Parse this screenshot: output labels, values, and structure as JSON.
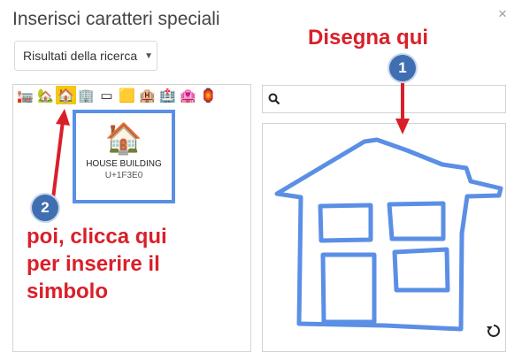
{
  "dialog": {
    "title": "Inserisci caratteri speciali",
    "close_icon": "×",
    "dropdown_label": "Risultati della ricerca"
  },
  "emoji_strip": [
    {
      "glyph": "🏣",
      "icon": "post-office-icon"
    },
    {
      "glyph": "🏡",
      "icon": "house-garden-icon"
    },
    {
      "glyph": "🏠",
      "icon": "house-building-icon",
      "selected": true
    },
    {
      "glyph": "🏢",
      "icon": "office-building-icon"
    },
    {
      "glyph": "▭",
      "icon": "empty-box-icon"
    },
    {
      "glyph": "🟨",
      "icon": "yellow-box-icon"
    },
    {
      "glyph": "🏨",
      "icon": "hotel-icon"
    },
    {
      "glyph": "🏥",
      "icon": "hospital-icon"
    },
    {
      "glyph": "🏩",
      "icon": "love-hotel-icon"
    },
    {
      "glyph": "🏮",
      "icon": "lantern-icon"
    }
  ],
  "preview": {
    "glyph": "🏠",
    "name": "HOUSE BUILDING",
    "codepoint": "U+1F3E0"
  },
  "annotations": {
    "draw_here": "Disegna qui",
    "click_here_line1": "poi, clicca qui",
    "click_here_line2": "per inserire il",
    "click_here_line3": "simbolo",
    "badge1": "1",
    "badge2": "2"
  },
  "colors": {
    "annotation_red": "#d9202a",
    "badge_blue": "#3f6fb1",
    "sketch_blue": "#5b8fe6",
    "selected_yellow": "#f5c518"
  }
}
